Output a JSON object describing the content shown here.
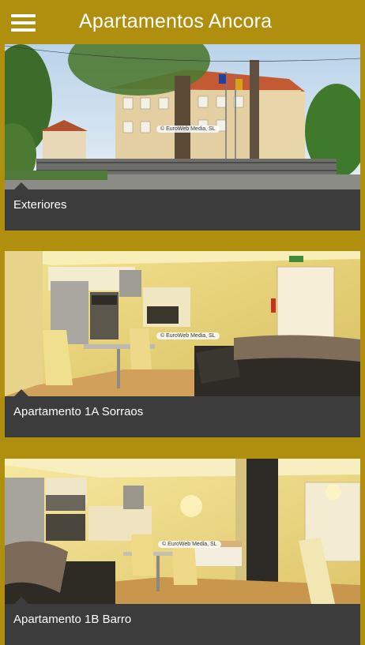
{
  "header": {
    "title": "Apartamentos Ancora",
    "menu_icon": "hamburger-menu-icon"
  },
  "colors": {
    "accent": "#b08e0e",
    "caption_bg": "#3c3c3c",
    "text": "#ffffff"
  },
  "cards": [
    {
      "label": "Exteriores",
      "watermark": "© EuroWeb Media, SL"
    },
    {
      "label": "Apartamento 1A Sorraos",
      "watermark": "© EuroWeb Media, SL"
    },
    {
      "label": "Apartamento 1B Barro",
      "watermark": "© EuroWeb Media, SL"
    }
  ]
}
